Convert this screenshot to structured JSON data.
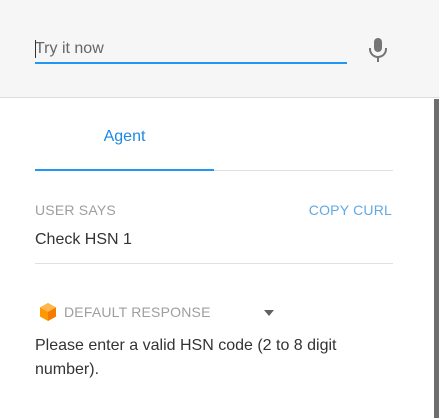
{
  "colors": {
    "accent": "#2196f3",
    "tab_active_text": "#1e88e5",
    "link": "#64a8e0",
    "muted_label": "#9e9e9e",
    "body_text": "#333333",
    "header_bg": "#f6f6f6",
    "response_icon": "#ff9800"
  },
  "tryit": {
    "placeholder": "Try it now",
    "mic_icon": "microphone-icon"
  },
  "tabs": [
    {
      "label": "Agent",
      "active": true
    }
  ],
  "user_says": {
    "label": "USER SAYS",
    "copy_link": "COPY CURL",
    "query": "Check HSN 1"
  },
  "response": {
    "icon": "cube-icon",
    "label": "DEFAULT RESPONSE",
    "dropdown_icon": "caret-down-icon",
    "text": "Please enter a valid HSN code (2 to 8 digit number)."
  }
}
